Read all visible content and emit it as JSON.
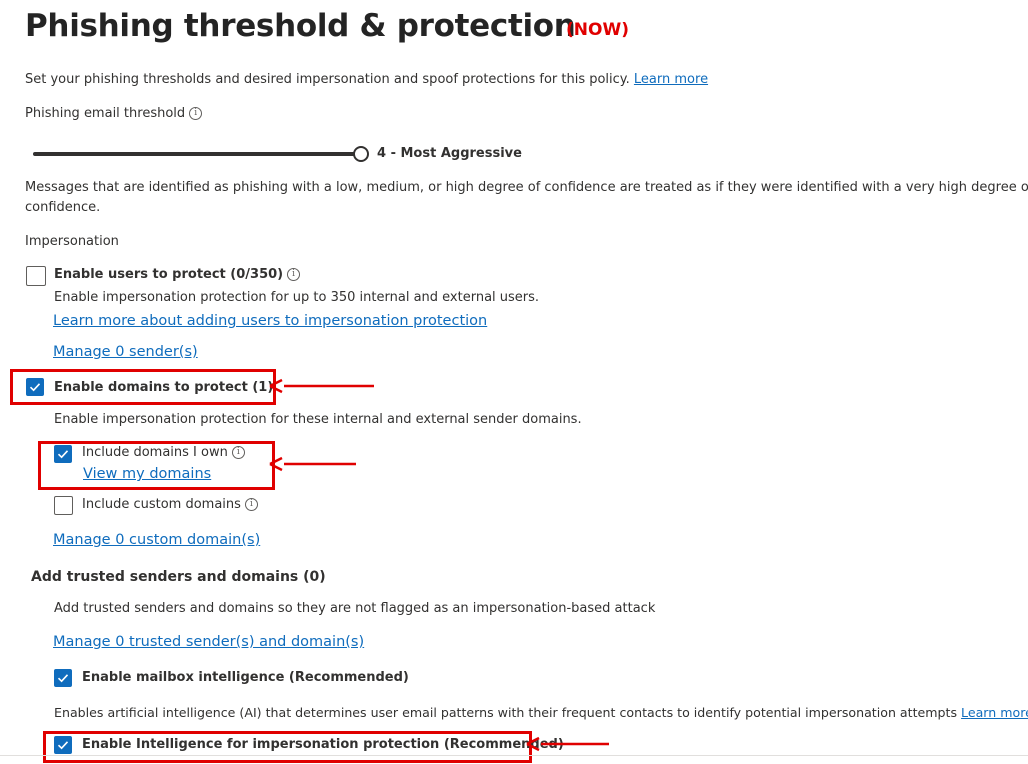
{
  "header": {
    "title": "Phishing threshold & protection",
    "annotation": "(NOW)"
  },
  "intro": {
    "text": "Set your phishing thresholds and desired impersonation and spoof protections for this policy.",
    "learn_more": "Learn more"
  },
  "threshold": {
    "label": "Phishing email threshold",
    "value_label": "4 - Most Aggressive",
    "level": 4,
    "max_level": 4,
    "description_line1": "Messages that are identified as phishing with a low, medium, or high degree of confidence are treated as if they were identified with a very high degree of",
    "description_line2": "confidence."
  },
  "impersonation": {
    "heading": "Impersonation",
    "users": {
      "label": "Enable users to protect (0/350)",
      "checked": false,
      "description": "Enable impersonation protection for up to 350 internal and external users.",
      "learn_link": "Learn more about adding users to impersonation protection",
      "manage_link": "Manage 0 sender(s)"
    },
    "domains": {
      "label": "Enable domains to protect (1)",
      "checked": true,
      "description": "Enable impersonation protection for these internal and external sender domains.",
      "include_owned": {
        "label": "Include domains I own",
        "checked": true,
        "link": "View my domains"
      },
      "include_custom": {
        "label": "Include custom domains",
        "checked": false
      },
      "manage_link": "Manage 0 custom domain(s)"
    }
  },
  "trusted": {
    "heading": "Add trusted senders and domains (0)",
    "description": "Add trusted senders and domains so they are not flagged as an impersonation-based attack",
    "manage_link": "Manage 0 trusted sender(s) and domain(s)"
  },
  "mailbox_intelligence": {
    "label": "Enable mailbox intelligence (Recommended)",
    "checked": true,
    "description": "Enables artificial intelligence (AI) that determines user email patterns with their frequent contacts to identify potential impersonation attempts",
    "learn_more": "Learn more"
  },
  "intelligence_protection": {
    "label": "Enable Intelligence for impersonation protection (Recommended)",
    "checked": true
  },
  "colors": {
    "accent": "#0f6cbd",
    "annotation_red": "#e00000",
    "text": "#323130"
  }
}
